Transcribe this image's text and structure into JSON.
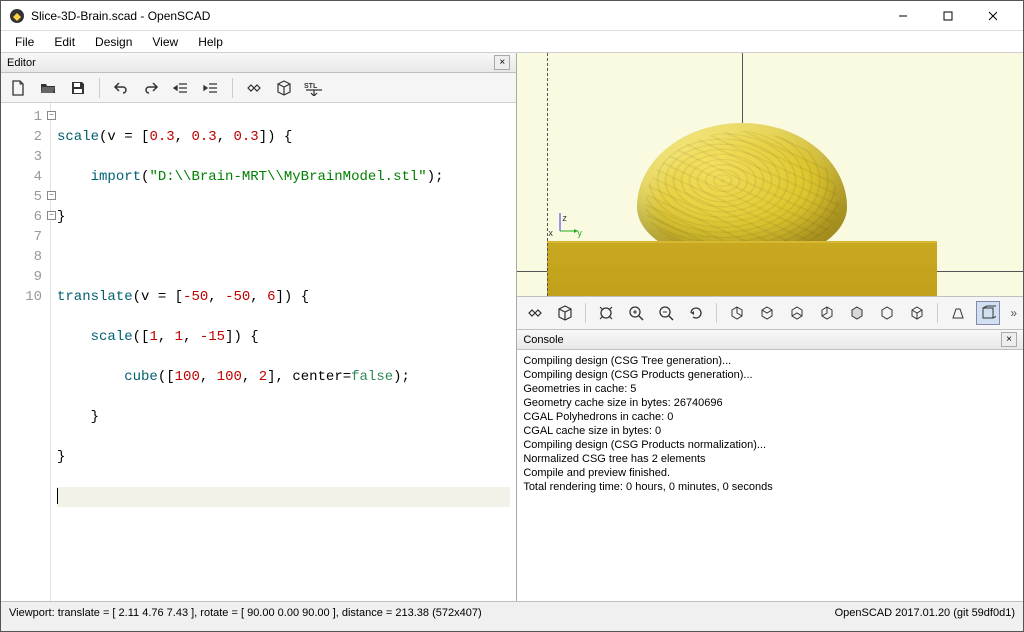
{
  "title": "Slice-3D-Brain.scad - OpenSCAD",
  "menus": {
    "file": "File",
    "edit": "Edit",
    "design": "Design",
    "view": "View",
    "help": "Help"
  },
  "panels": {
    "editor": "Editor",
    "console": "Console"
  },
  "line_numbers": [
    "1",
    "2",
    "3",
    "4",
    "5",
    "6",
    "7",
    "8",
    "9",
    "10"
  ],
  "code": {
    "l1a": "scale",
    "l1b": "(v = [",
    "l1c": "0.3",
    "l1d": ", ",
    "l1e": "0.3",
    "l1f": ", ",
    "l1g": "0.3",
    "l1h": "]) {",
    "l2a": "    ",
    "l2b": "import",
    "l2c": "(",
    "l2d": "\"D:\\\\Brain-MRT\\\\MyBrainModel.stl\"",
    "l2e": ");",
    "l3": "}",
    "l4": "",
    "l5a": "translate",
    "l5b": "(v = [",
    "l5c": "-50",
    "l5d": ", ",
    "l5e": "-50",
    "l5f": ", ",
    "l5g": "6",
    "l5h": "]) {",
    "l6a": "    ",
    "l6b": "scale",
    "l6c": "([",
    "l6d": "1",
    "l6e": ", ",
    "l6f": "1",
    "l6g": ", ",
    "l6h": "-15",
    "l6i": "]) {",
    "l7a": "        ",
    "l7b": "cube",
    "l7c": "([",
    "l7d": "100",
    "l7e": ", ",
    "l7f": "100",
    "l7g": ", ",
    "l7h": "2",
    "l7i": "], center=",
    "l7j": "false",
    "l7k": ");",
    "l8": "    }",
    "l9": "}"
  },
  "console_lines": [
    "Compiling design (CSG Tree generation)...",
    "Compiling design (CSG Products generation)...",
    "Geometries in cache: 5",
    "Geometry cache size in bytes: 26740696",
    "CGAL Polyhedrons in cache: 0",
    "CGAL cache size in bytes: 0",
    "Compiling design (CSG Products normalization)...",
    "Normalized CSG tree has 2 elements",
    "Compile and preview finished.",
    "Total rendering time: 0 hours, 0 minutes, 0 seconds"
  ],
  "status": {
    "left": "Viewport: translate = [ 2.11 4.76 7.43 ], rotate = [ 90.00 0.00 90.00 ], distance = 213.38 (572x407)",
    "right": "OpenSCAD 2017.01.20 (git 59df0d1)"
  },
  "axes": {
    "x": "x",
    "y": "y",
    "z": "z"
  }
}
